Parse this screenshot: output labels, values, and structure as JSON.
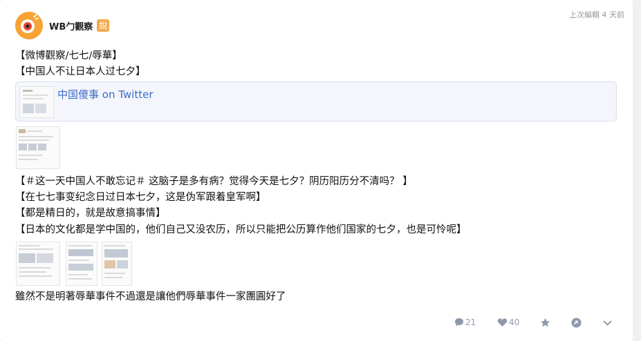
{
  "post": {
    "author": "WB勹觀察",
    "badge": "說",
    "edited": "上次編輯 4 天前",
    "lines_top": [
      "【微博觀察/七七/辱華】",
      "【中国人不让日本人过七夕】"
    ],
    "link_title": "中国傻事 on Twitter",
    "lines_mid": [
      "【＃这一天中国人不敢忘记＃  这脑子是多有病？觉得今天是七夕？阴历阳历分不清吗？ 】",
      "【在七七事变纪念日过日本七夕，这是伪军跟着皇军啊】",
      "【都是精日的，就是故意搞事情】",
      "【日本的文化都是学中国的，他们自己又没农历，所以只能把公历算作他们国家的七夕，也是可怜呢】"
    ],
    "line_bottom": "雖然不是明著辱華事件不過還是讓他們辱華事件一家團圓好了"
  },
  "actions": {
    "comments": "21",
    "likes": "40"
  },
  "colors": {
    "avatar_bg": "#f7a335",
    "badge_bg": "#f1a94c",
    "link": "#3b6bc9",
    "icon": "#8f98ab"
  }
}
